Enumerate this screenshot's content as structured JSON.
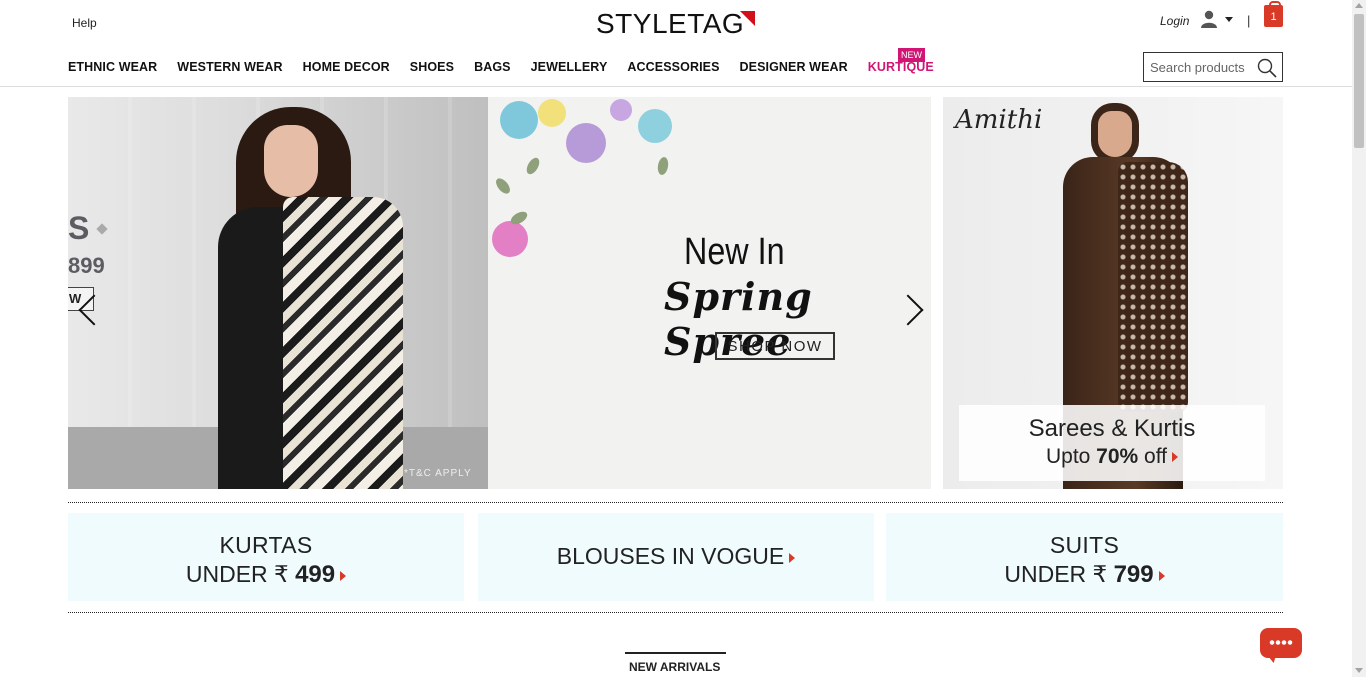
{
  "header": {
    "help_label": "Help",
    "logo_text": "STYLETAG",
    "login_label": "Login",
    "separator": "|",
    "cart_count": "1"
  },
  "nav": {
    "items": [
      {
        "label": "ETHNIC WEAR"
      },
      {
        "label": "WESTERN WEAR"
      },
      {
        "label": "HOME DECOR"
      },
      {
        "label": "SHOES"
      },
      {
        "label": "BAGS"
      },
      {
        "label": "JEWELLERY"
      },
      {
        "label": "ACCESSORIES"
      },
      {
        "label": "DESIGNER WEAR"
      },
      {
        "label": "KURTIQUE"
      }
    ],
    "new_badge": "NEW"
  },
  "search": {
    "placeholder": "Search products"
  },
  "hero": {
    "left": {
      "peek_title": "S",
      "peek_price": "899",
      "peek_button": "W",
      "terms": "*T&C APPLY"
    },
    "center": {
      "line1": "New In",
      "line2": "Spring Spree",
      "cta": "SHOP NOW"
    },
    "right": {
      "brand": "Amithi",
      "title": "Sarees & Kurtis",
      "offer_prefix": "Upto ",
      "offer_value": "70%",
      "offer_suffix": " off"
    }
  },
  "tiles": [
    {
      "line1": "KURTAS",
      "line2_prefix": "UNDER ₹ ",
      "line2_value": "499"
    },
    {
      "label": "BLOUSES IN VOGUE"
    },
    {
      "line1": "SUITS",
      "line2_prefix": "UNDER ₹ ",
      "line2_value": "799"
    }
  ],
  "section": {
    "new_arrivals": "NEW ARRIVALS"
  },
  "colors": {
    "accent_red": "#d93a27",
    "kurtique_pink": "#d01575",
    "tile_bg": "#effbfd"
  },
  "icons": {
    "user": "user-icon",
    "cart": "shopping-bag-icon",
    "search": "search-icon",
    "chat": "chat-bubble-icon"
  }
}
